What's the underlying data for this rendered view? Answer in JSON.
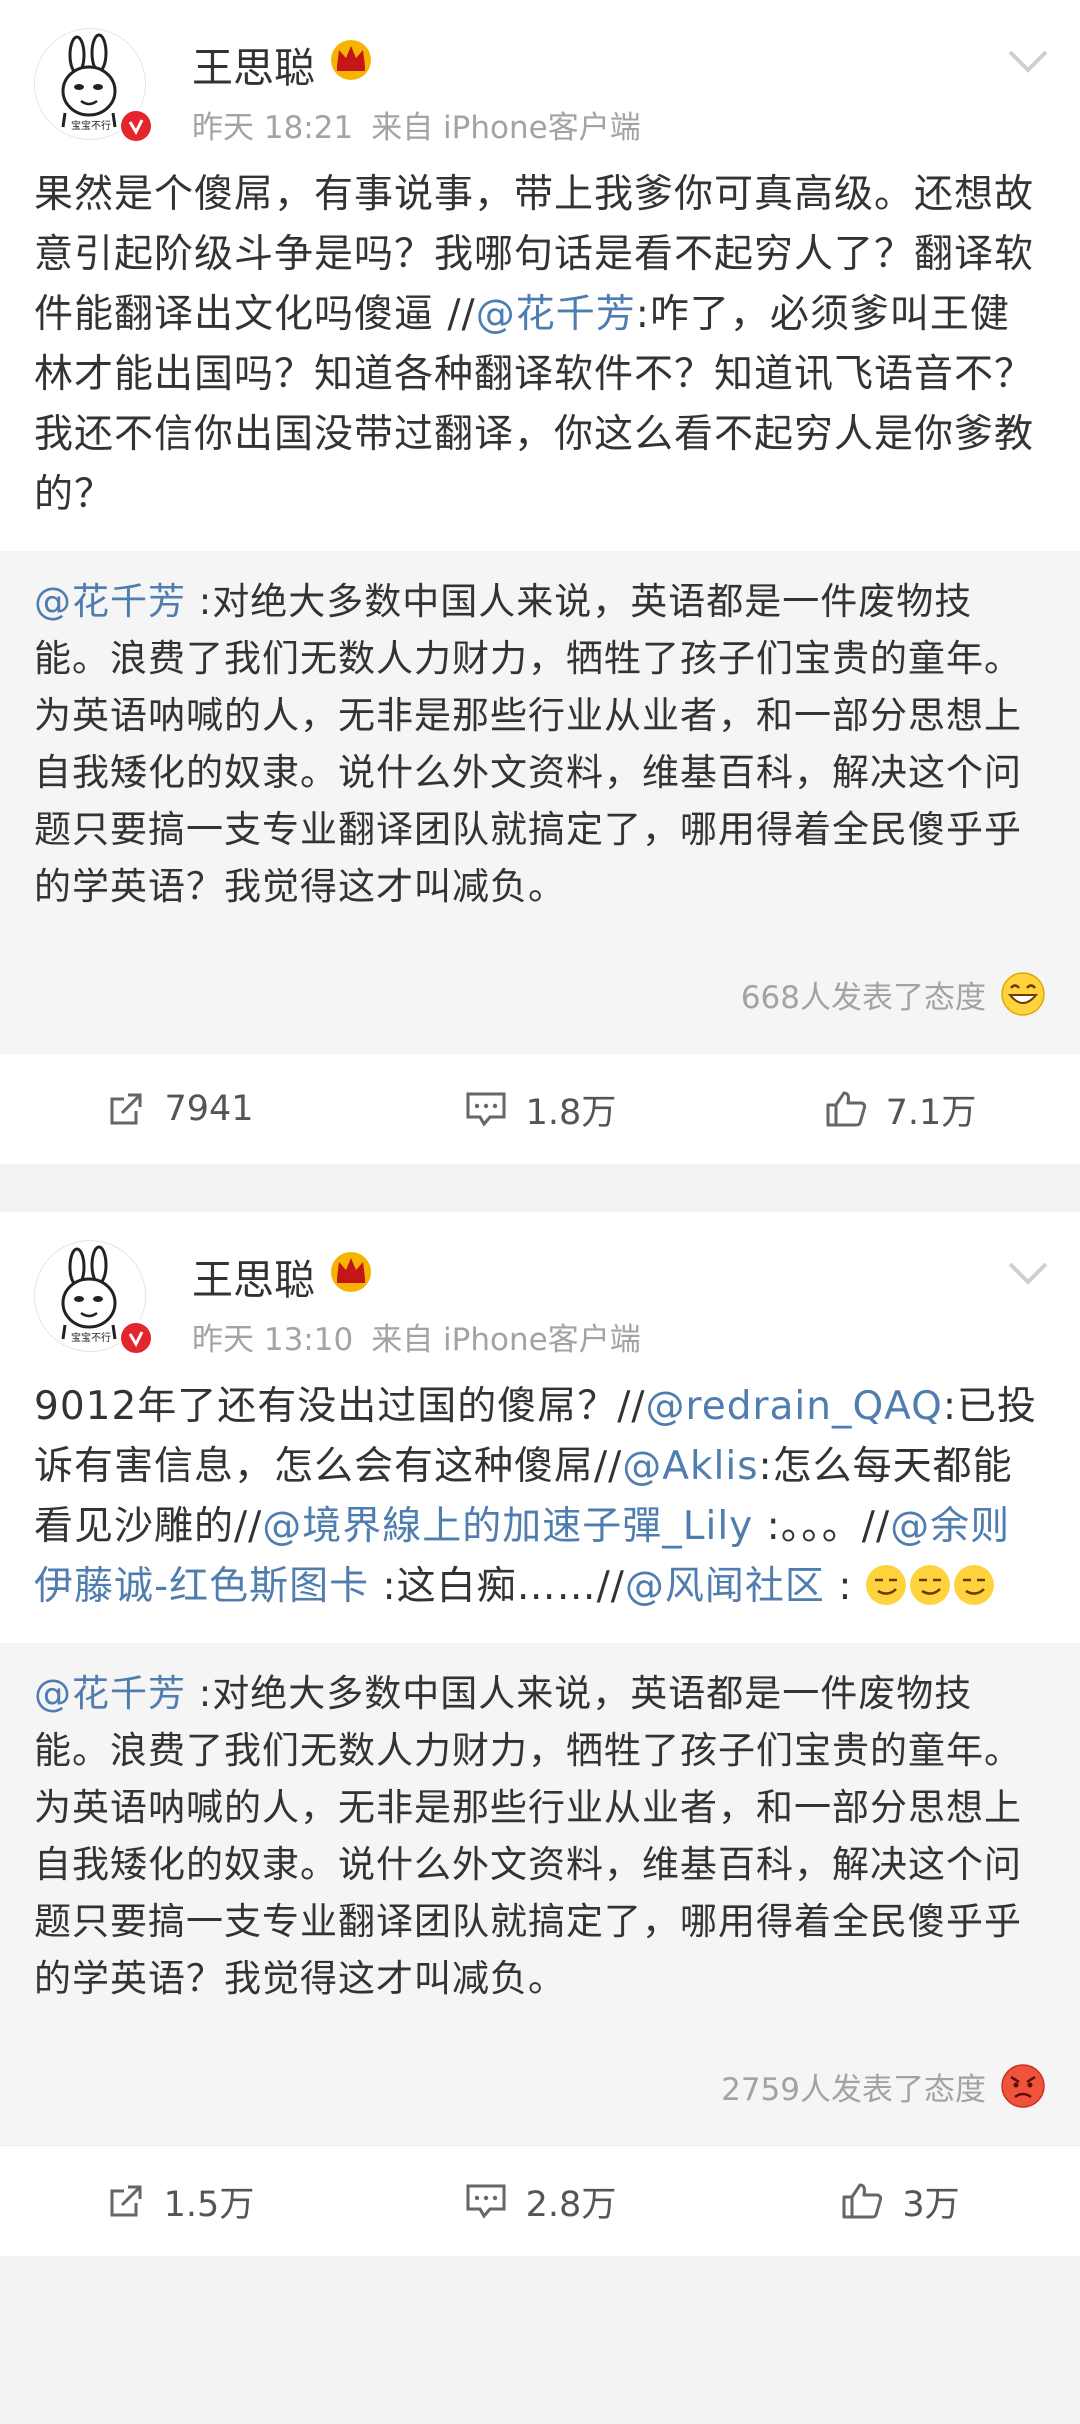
{
  "posts": [
    {
      "username": "王思聪",
      "time": "昨天 18:21",
      "source": "来自 iPhone客户端",
      "avatar_text": "宝宝不行",
      "body": [
        {
          "t": "果然是个傻屌，有事说事，带上我爹你可真高级。还想故意引起阶级斗争是吗？我哪句话是看不起穷人了？翻译软件能翻译出文化吗傻逼 //"
        },
        {
          "m": "@花千芳"
        },
        {
          "t": ":咋了，必须爹叫王健林才能出国吗？知道各种翻译软件不？知道讯飞语音不？我还不信你出国没带过翻译，你这么看不起穷人是你爹教的？"
        }
      ],
      "quote": {
        "mention": "@花千芳",
        "text1": " :对绝大多数中国人来说，英语都是一件废物技能。浪费了我们无数人力财力，牺牲了孩子们宝贵的童年。",
        "text2": "为英语呐喊的人，无非是那些行业从业者，和一部分思想上自我矮化的奴隶。说什么外文资料，维基百科，解决这个问题只要搞一支专业翻译团队就搞定了，哪用得着全民傻乎乎的学英语？我觉得这才叫减负。"
      },
      "attitude_text": "668人发表了态度",
      "attitude_emoji": "grinning-emoji",
      "repost_count": "7941",
      "comment_count": "1.8万",
      "like_count": "7.1万"
    },
    {
      "username": "王思聪",
      "time": "昨天 13:10",
      "source": "来自 iPhone客户端",
      "avatar_text": "宝宝不行",
      "body": [
        {
          "t": "9012年了还有没出过国的傻屌？//"
        },
        {
          "m": "@redrain_QAQ"
        },
        {
          "t": ":已投诉有害信息，怎么会有这种傻屌//"
        },
        {
          "m": "@Aklis"
        },
        {
          "t": ":怎么每天都能看见沙雕的//"
        },
        {
          "m": "@境界線上的加速子彈_Lily"
        },
        {
          "t": " :。。。//"
        },
        {
          "m": "@余则伊藤诚-红色斯图卡"
        },
        {
          "t": " :这白痴……//"
        },
        {
          "m": "@风闻社区"
        },
        {
          "t": " : "
        }
      ],
      "quote": {
        "mention": "@花千芳",
        "text1": " :对绝大多数中国人来说，英语都是一件废物技能。浪费了我们无数人力财力，牺牲了孩子们宝贵的童年。",
        "text2": "为英语呐喊的人，无非是那些行业从业者，和一部分思想上自我矮化的奴隶。说什么外文资料，维基百科，解决这个问题只要搞一支专业翻译团队就搞定了，哪用得着全民傻乎乎的学英语？我觉得这才叫减负。"
      },
      "attitude_text": "2759人发表了态度",
      "attitude_emoji": "angry-emoji",
      "repost_count": "1.5万",
      "comment_count": "2.8万",
      "like_count": "3万"
    }
  ],
  "colors": {
    "mention": "#507daf",
    "verified_badge": "#e2262b",
    "crown": "#f6b400",
    "meta": "#a3a3a3"
  }
}
